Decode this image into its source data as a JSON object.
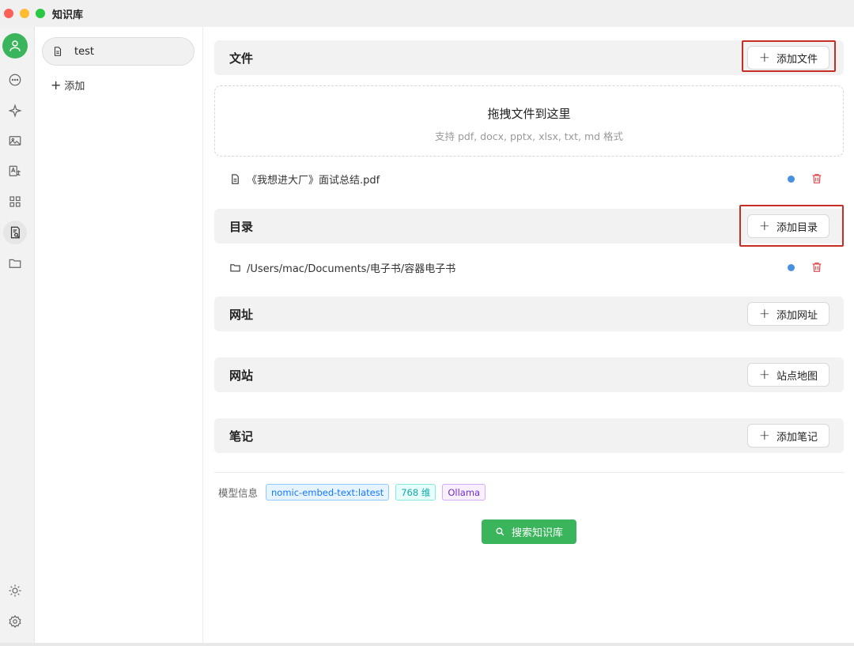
{
  "window": {
    "title": "知识库"
  },
  "sidebar_icons": [
    "user-avatar-icon",
    "chat-icon",
    "sparkle-icon",
    "image-icon",
    "translate-icon",
    "apps-icon",
    "knowledge-icon",
    "folder-icon",
    "theme-icon",
    "settings-icon"
  ],
  "knowledge_list": {
    "items": [
      {
        "label": "test"
      }
    ],
    "add_label": "添加"
  },
  "sections": {
    "files": {
      "title": "文件",
      "button": "添加文件",
      "dropzone": {
        "title": "拖拽文件到这里",
        "subtitle": "支持 pdf, docx, pptx, xlsx, txt, md 格式"
      },
      "items": [
        {
          "name": "《我想进大厂》面试总结.pdf",
          "status_color": "#4a90e2"
        }
      ]
    },
    "directories": {
      "title": "目录",
      "button": "添加目录",
      "items": [
        {
          "name": "/Users/mac/Documents/电子书/容器电子书",
          "status_color": "#4a90e2"
        }
      ]
    },
    "urls": {
      "title": "网址",
      "button": "添加网址"
    },
    "websites": {
      "title": "网站",
      "button": "站点地图"
    },
    "notes": {
      "title": "笔记",
      "button": "添加笔记"
    }
  },
  "model_info": {
    "label": "模型信息",
    "tags": [
      {
        "text": "nomic-embed-text:latest",
        "color": "#1677ff"
      },
      {
        "text": "768 维",
        "color": "#13a8a8"
      },
      {
        "text": "Ollama",
        "color": "#722ed1"
      }
    ]
  },
  "search_button": "搜索知识库",
  "colors": {
    "accent": "#3bb55c",
    "highlight_box": "#c62d24",
    "delete": "#e0474c"
  }
}
